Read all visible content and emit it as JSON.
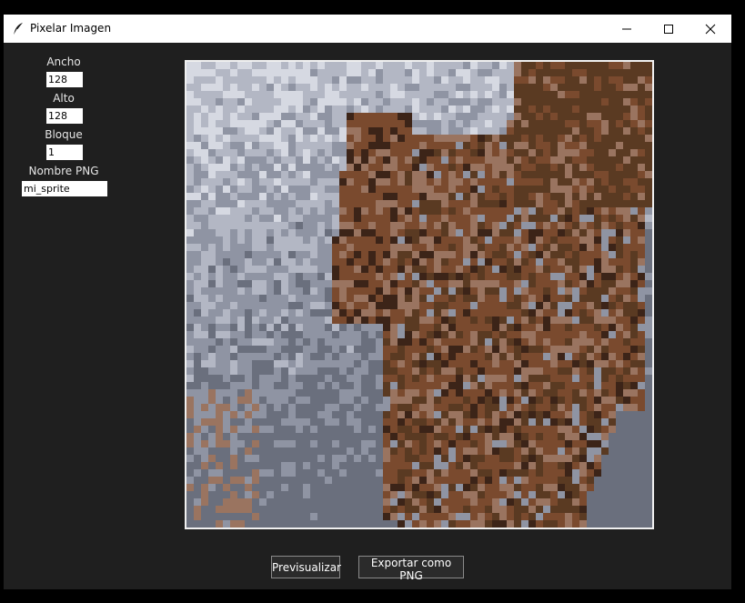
{
  "window": {
    "title": "Pixelar Imagen"
  },
  "form": {
    "ancho": {
      "label": "Ancho",
      "value": "128"
    },
    "alto": {
      "label": "Alto",
      "value": "128"
    },
    "bloque": {
      "label": "Bloque",
      "value": "1"
    },
    "nombre": {
      "label": "Nombre PNG",
      "value": "mi_sprite"
    }
  },
  "buttons": {
    "preview_label": "Previsualizar",
    "export_label": "Exportar como PNG"
  },
  "preview": {
    "subject": "pixelated dragon image",
    "palette": [
      "#5a3a22",
      "#7a4a2e",
      "#9a7460",
      "#6a6f7d",
      "#8f94a3",
      "#b3b7c4",
      "#d6d9e2",
      "#3c2418"
    ]
  },
  "colors": {
    "window_bg": "#1f1f1f",
    "titlebar_bg": "#ffffff",
    "label_text": "#e6e6e6",
    "button_bg": "#2b2b2b"
  }
}
